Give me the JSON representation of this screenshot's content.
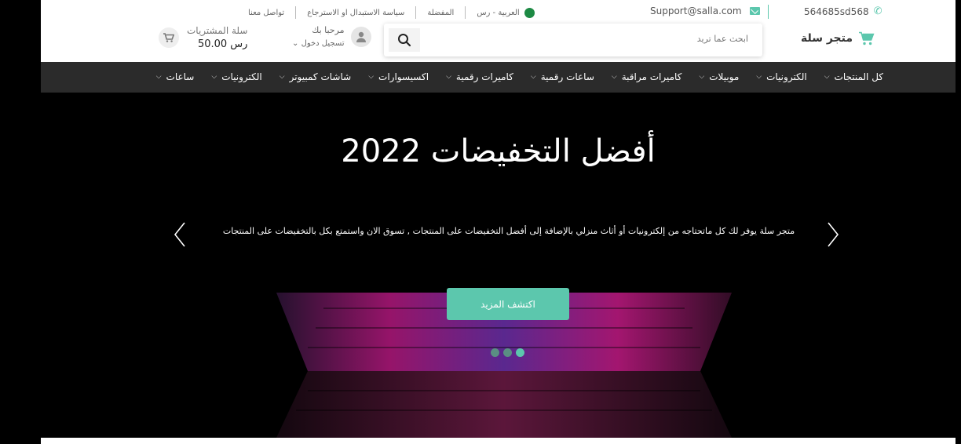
{
  "topbar": {
    "contact_us": "تواصل معنا",
    "return_policy": "سياسة الاستبدال او الاسترجاع",
    "wishlist": "المفضلة",
    "language_currency": "العربية - رس",
    "email": "Support@salla.com",
    "phone": "564685sd568"
  },
  "header": {
    "store_name": "متجر سلة",
    "search_placeholder": "ابحث عما تريد",
    "greeting": "مرحبا بك",
    "login_label": "تسجيل دخول",
    "cart_label": "سلة المشتريات",
    "cart_total": "50.00 رس"
  },
  "nav": {
    "items": [
      {
        "label": "كل المنتجات"
      },
      {
        "label": "الكترونيات"
      },
      {
        "label": "موبيلات"
      },
      {
        "label": "كاميرات مراقبة"
      },
      {
        "label": "ساعات رقمية"
      },
      {
        "label": "كاميرات رقمية"
      },
      {
        "label": "اكسيسوارات"
      },
      {
        "label": "شاشات كمبيوتر"
      },
      {
        "label": "الكترونيات"
      },
      {
        "label": "ساعات"
      }
    ]
  },
  "hero": {
    "title": "أفضل التخفيضات 2022",
    "subtitle": "متجر سلة يوفر لك كل ماتحتاجه من إلكترونيات أو أثاث منزلي بالإضافة إلى أفضل التخفيضات على المنتجات , تسوق الان واستمتع بكل بالتخفيضات على المنتجات",
    "cta_label": "اكتشف المزيد",
    "slide_count": 3,
    "active_slide": 3
  },
  "colors": {
    "accent": "#5cc7ad",
    "nav_bg": "#2b2b2b",
    "hero_bg": "#000000"
  },
  "icons": {
    "cart": "shopping-cart-icon",
    "search": "search-icon",
    "user": "user-icon",
    "mail": "mail-icon",
    "phone": "whatsapp-icon",
    "flag": "saudi-flag-icon"
  }
}
